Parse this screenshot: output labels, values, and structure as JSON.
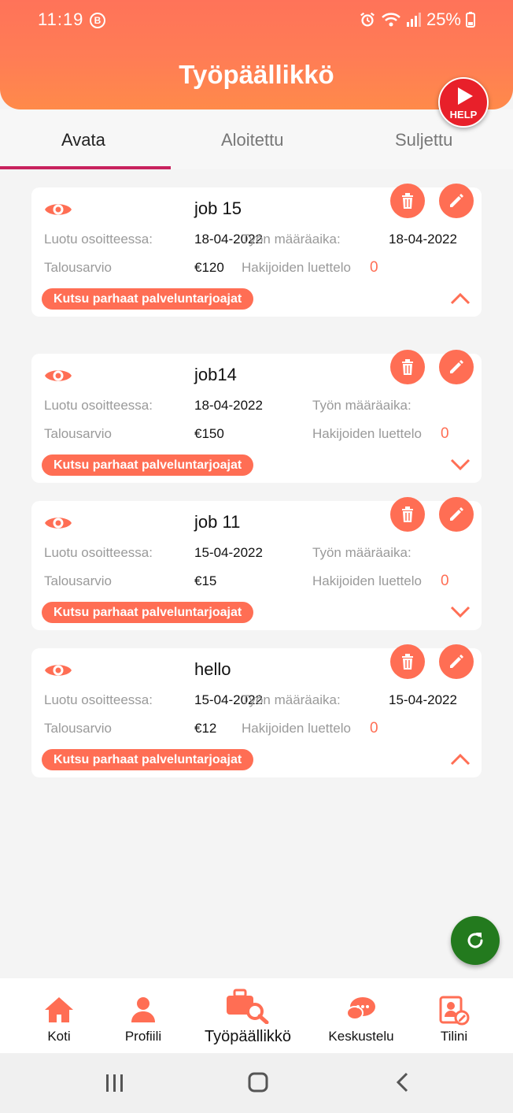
{
  "status_bar": {
    "time": "11:19",
    "battery": "25%"
  },
  "app_title": "Työpäällikkö",
  "help_label": "HELP",
  "tabs": [
    {
      "label": "Avata",
      "active": true
    },
    {
      "label": "Aloitettu",
      "active": false
    },
    {
      "label": "Suljettu",
      "active": false
    }
  ],
  "labels": {
    "created": "Luotu osoitteessa:",
    "deadline": "Työn määräaika:",
    "budget": "Talousarvio",
    "applicants": "Hakijoiden luettelo",
    "invite": "Kutsu parhaat palveluntarjoajat"
  },
  "jobs": [
    {
      "title": "job 15",
      "created": "18-04-2022",
      "deadline": "18-04-2022",
      "budget": "€120",
      "applicants": "0",
      "expanded": true
    },
    {
      "title": "job14",
      "created": "18-04-2022",
      "deadline": "",
      "budget": "€150",
      "applicants": "0",
      "expanded": false
    },
    {
      "title": "job 11",
      "created": "15-04-2022",
      "deadline": "",
      "budget": "€15",
      "applicants": "0",
      "expanded": false
    },
    {
      "title": "hello",
      "created": "15-04-2022",
      "deadline": "15-04-2022",
      "budget": "€12",
      "applicants": "0",
      "expanded": true
    }
  ],
  "bottom_nav": [
    {
      "label": "Koti",
      "icon": "home-icon"
    },
    {
      "label": "Profiili",
      "icon": "profile-icon"
    },
    {
      "label": "Työpäällikkö",
      "icon": "job-manager-icon",
      "active": true
    },
    {
      "label": "Keskustelu",
      "icon": "chat-icon"
    },
    {
      "label": "Tilini",
      "icon": "account-icon"
    }
  ],
  "colors": {
    "accent": "#ff6e54",
    "header": "#ff7359",
    "tab_indicator": "#c8235e",
    "refresh_fab": "#237a1e",
    "help": "#e8202a"
  }
}
